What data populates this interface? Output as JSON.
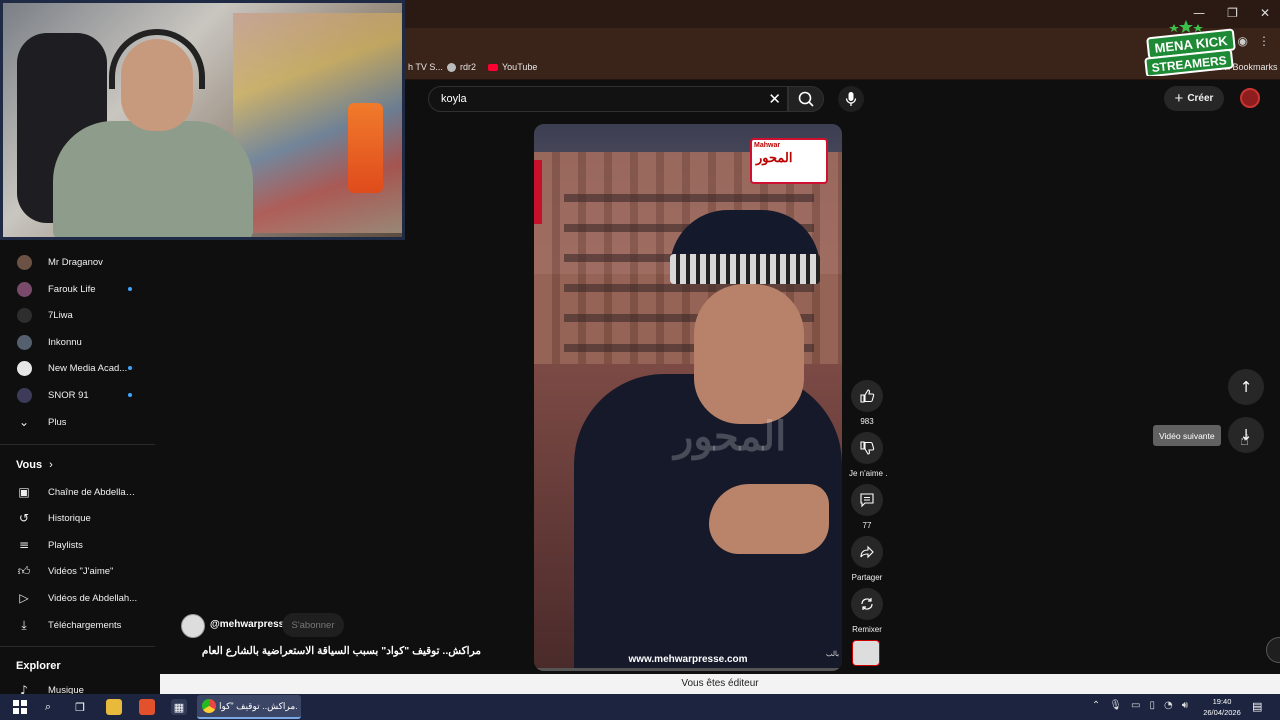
{
  "browser": {
    "bookmarks": [
      {
        "label": "h TV S..."
      },
      {
        "label": "rdr2"
      },
      {
        "label": "YouTube"
      }
    ],
    "all_bookmarks": "All Bookmarks",
    "window_controls": {
      "minimize": "—",
      "maximize": "❐",
      "close": "✕"
    }
  },
  "overlay_logo": {
    "line1": "MENA KICK",
    "line2": "STREAMERS"
  },
  "header": {
    "search_value": "koyla",
    "create_label": "Créer"
  },
  "sidebar": {
    "subscriptions": [
      {
        "label": "Mr Draganov",
        "new": false
      },
      {
        "label": "Farouk Life",
        "new": true
      },
      {
        "label": "7Liwa",
        "new": false
      },
      {
        "label": "Inkonnu",
        "new": false
      },
      {
        "label": "New Media Acad...",
        "new": true
      },
      {
        "label": "SNOR 91",
        "new": true
      }
    ],
    "more_label": "Plus",
    "you_section": "Vous",
    "you_items": [
      {
        "label": "Chaîne de Abdellah..."
      },
      {
        "label": "Historique"
      },
      {
        "label": "Playlists"
      },
      {
        "label": "Vidéos \"J'aime\""
      },
      {
        "label": "Vidéos de Abdellah..."
      },
      {
        "label": "Téléchargements"
      }
    ],
    "explore_section": "Explorer",
    "explore_items": [
      {
        "label": "Musique"
      }
    ]
  },
  "short": {
    "logo_text": "المحور",
    "logo_small": "Mahwar",
    "watermark": "المحور",
    "url_overlay": "www.mehwarpresse.com",
    "progress": 0.0,
    "channel": "@mehwarpress",
    "subscribe_label": "S'abonner",
    "title": "مراكش.. توقيف \"كواد\" بسبب السياقة الاستعراضية بالشارع العام"
  },
  "actions": {
    "likes": "983",
    "dislike_label": "Je n'aime .",
    "comments": "77",
    "share_label": "Partager",
    "remix_label": "Remixer",
    "sound_label": "بالب"
  },
  "navigation": {
    "next_tooltip": "Vidéo suivante"
  },
  "editor_bar": "Vous êtes éditeur",
  "taskbar": {
    "active_window": "مراكش.. توقيف \"كوا...",
    "time": "19:40",
    "date": "26/04/2026"
  },
  "colors": {
    "accent": "#ff0033",
    "link_dot": "#3ea6ff",
    "titlebar": "#2b1a14"
  }
}
